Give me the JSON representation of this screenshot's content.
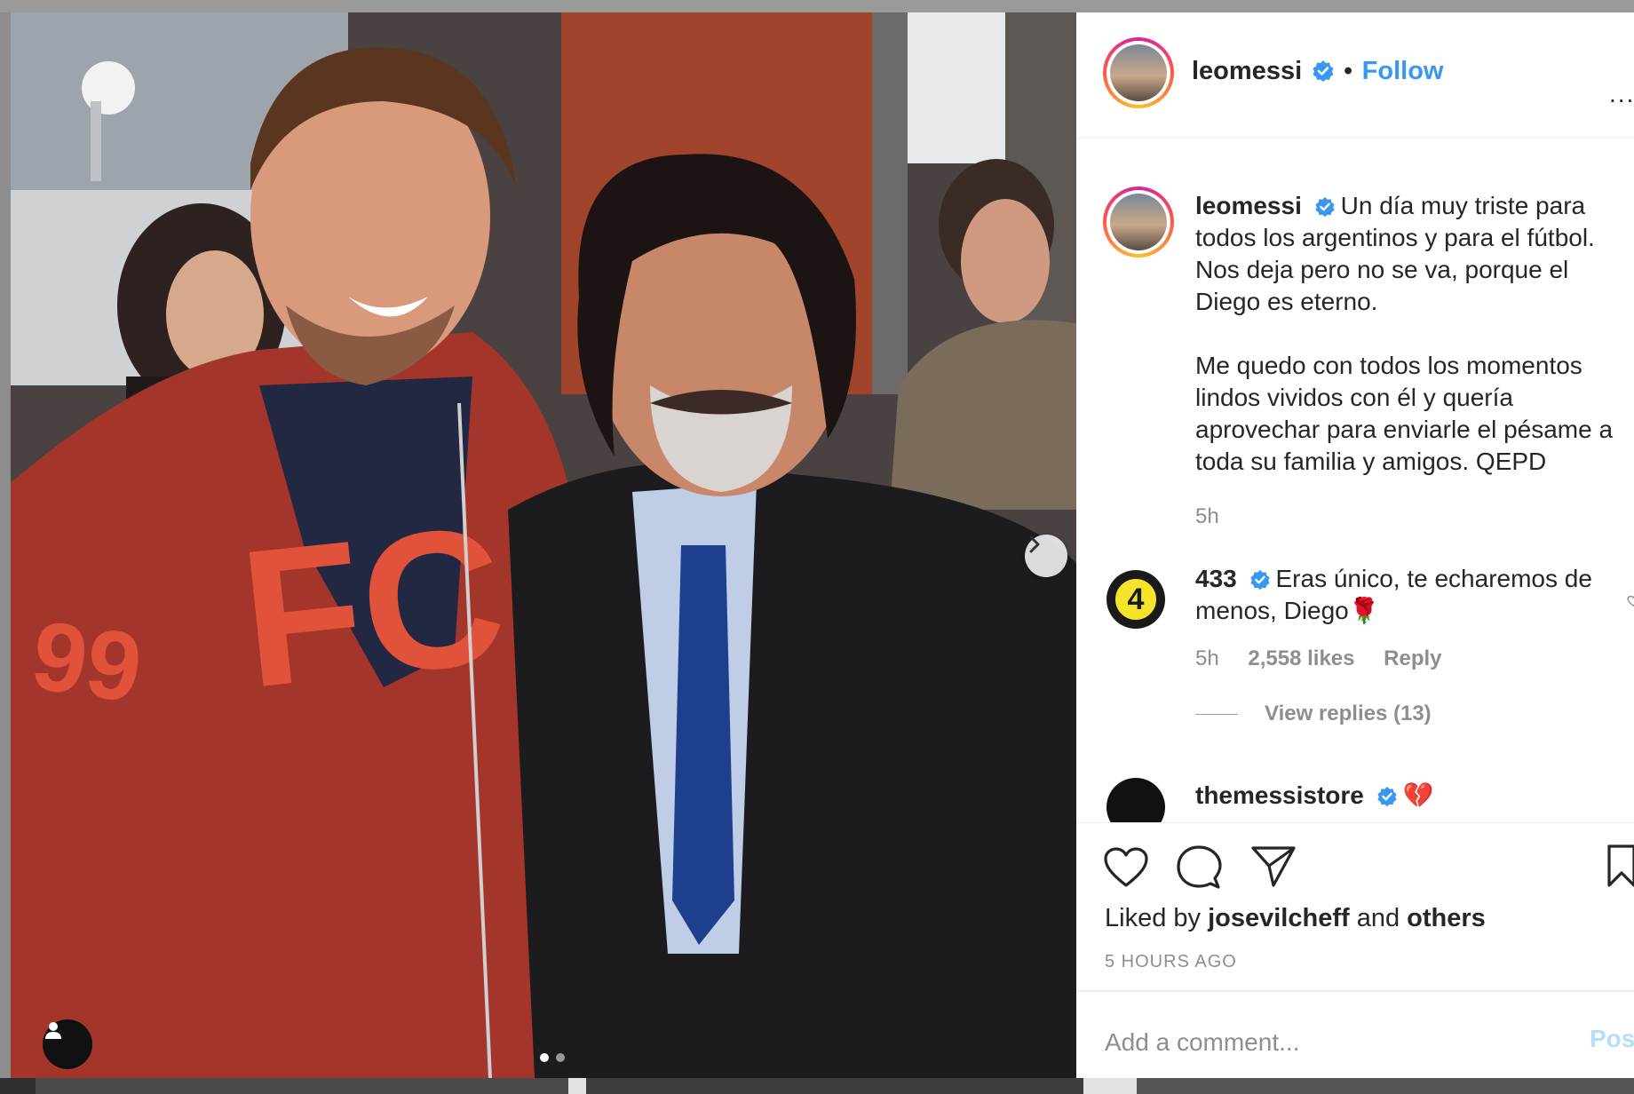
{
  "colors": {
    "accent_blue": "#3897f0",
    "text_primary": "#262626",
    "text_secondary": "#8e8e8e",
    "post_disabled": "#b2dffc"
  },
  "post": {
    "carousel_total": 2,
    "carousel_index": 1
  },
  "header": {
    "username": "leomessi",
    "separator": "•",
    "follow_label": "Follow",
    "more_label": "..."
  },
  "caption": {
    "username": "leomessi",
    "paragraph1": "Un día muy triste para todos los argentinos y para el fútbol. Nos deja pero no se va, porque el Diego es eterno.",
    "paragraph2": "Me quedo con todos los momentos lindos vividos con él y quería aprovechar para enviarle el pésame a toda su familia y amigos. QEPD",
    "time": "5h"
  },
  "comments": [
    {
      "username": "433",
      "avatar_text": "4",
      "text": "Eras único, te echaremos de menos, Diego🌹",
      "time": "5h",
      "likes": "2,558 likes",
      "reply_label": "Reply",
      "view_replies": "View replies (13)"
    },
    {
      "username": "themessistore",
      "text": "💔"
    }
  ],
  "footer": {
    "liked_by_prefix": "Liked by",
    "liked_by_user": "josevilcheff",
    "liked_by_and": "and",
    "liked_by_others": "others",
    "time_ago": "5 HOURS AGO",
    "comment_placeholder": "Add a comment...",
    "post_label": "Post"
  }
}
